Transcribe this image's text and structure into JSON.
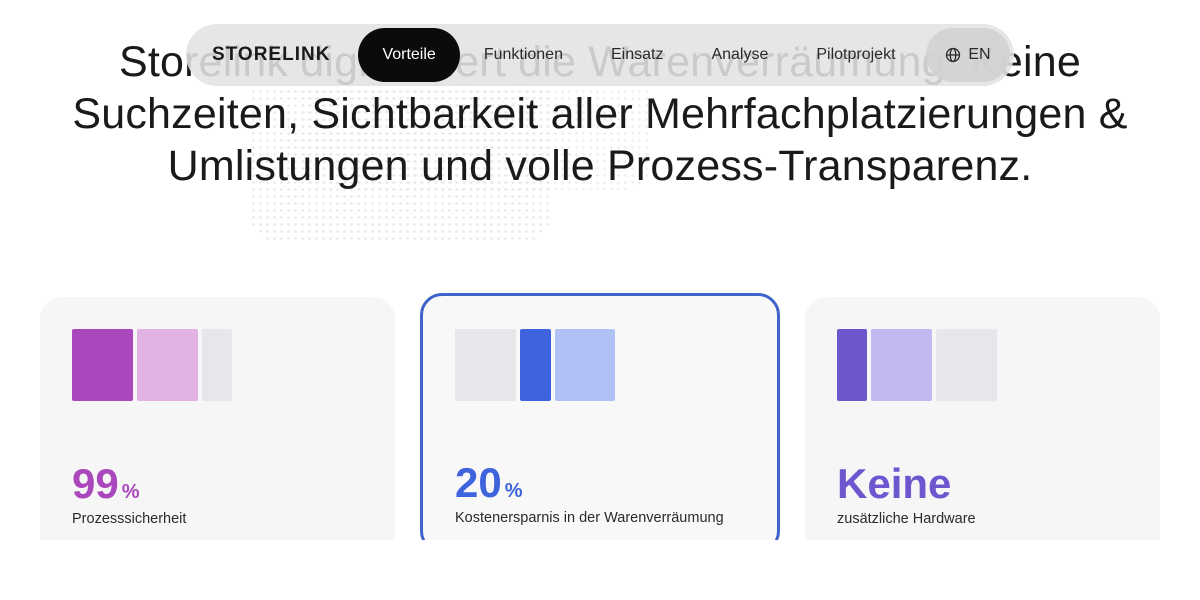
{
  "headline": "Storelink digitalisiert die Warenverräumung: Keine Suchzeiten, Sichtbarkeit aller Mehrfachplatzierungen & Umlistungen und volle Prozess-Transparenz.",
  "nav": {
    "logo": "STORELINK",
    "items": [
      {
        "label": "Vorteile",
        "active": true
      },
      {
        "label": "Funktionen"
      },
      {
        "label": "Einsatz"
      },
      {
        "label": "Analyse"
      },
      {
        "label": "Pilotprojekt"
      }
    ],
    "language": {
      "icon": "globe-icon",
      "label": "EN"
    }
  },
  "cards": [
    {
      "value": "99",
      "unit": "%",
      "caption": "Prozesssicherheit",
      "accent": "#ab47bc",
      "bars": [
        {
          "color": "#ab47bc",
          "w": 61
        },
        {
          "color": "#e1b2e3",
          "w": 61
        },
        {
          "color": "#e6e7ea",
          "w": 30
        }
      ]
    },
    {
      "value": "20",
      "unit": "%",
      "caption": "Kostenersparnis in der Warenverräumung",
      "accent": "#3e63dd",
      "selected_border": "#3e63c9",
      "bars": [
        {
          "color": "#e6e7ea",
          "w": 61
        },
        {
          "color": "#3e63dd",
          "w": 31
        },
        {
          "color": "#b0c2f5",
          "w": 60
        }
      ]
    },
    {
      "value": "Keine",
      "unit": "",
      "caption": "zusätzliche Hardware",
      "accent": "#6e56cf",
      "bars": [
        {
          "color": "#6e56cf",
          "w": 30
        },
        {
          "color": "#c4b8f0",
          "w": 61
        },
        {
          "color": "#e6e7ea",
          "w": 61
        }
      ]
    }
  ]
}
